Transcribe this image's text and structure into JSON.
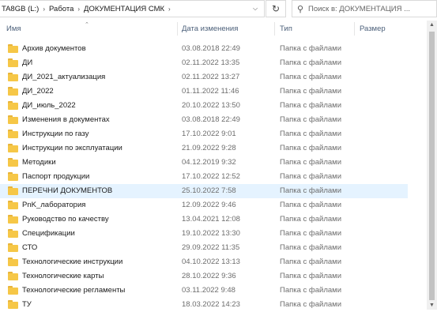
{
  "address": {
    "segments": [
      "TA8GB (L:)",
      "Работа",
      "ДОКУМЕНТАЦИЯ СМК"
    ],
    "dropdown_icon": "chevron-down-icon",
    "refresh_icon": "refresh-icon"
  },
  "search": {
    "placeholder": "Поиск в: ДОКУМЕНТАЦИЯ ...",
    "icon": "search-icon"
  },
  "columns": {
    "name": "Имя",
    "date": "Дата изменения",
    "type": "Тип",
    "size": "Размер"
  },
  "rows": [
    {
      "name": "Архив документов",
      "date": "03.08.2018 22:49",
      "type": "Папка с файлами"
    },
    {
      "name": "ДИ",
      "date": "02.11.2022 13:35",
      "type": "Папка с файлами"
    },
    {
      "name": "ДИ_2021_актуализация",
      "date": "02.11.2022 13:27",
      "type": "Папка с файлами"
    },
    {
      "name": "ДИ_2022",
      "date": "01.11.2022 11:46",
      "type": "Папка с файлами"
    },
    {
      "name": "ДИ_июль_2022",
      "date": "20.10.2022 13:50",
      "type": "Папка с файлами"
    },
    {
      "name": "Изменения в документах",
      "date": "03.08.2018 22:49",
      "type": "Папка с файлами"
    },
    {
      "name": "Инструкции по газу",
      "date": "17.10.2022 9:01",
      "type": "Папка с файлами"
    },
    {
      "name": "Инструкции по эксплуатации",
      "date": "21.09.2022 9:28",
      "type": "Папка с файлами"
    },
    {
      "name": "Методики",
      "date": "04.12.2019 9:32",
      "type": "Папка с файлами"
    },
    {
      "name": "Паспорт продукции",
      "date": "17.10.2022 12:52",
      "type": "Папка с файлами"
    },
    {
      "name": "ПЕРЕЧНИ ДОКУМЕНТОВ",
      "date": "25.10.2022 7:58",
      "type": "Папка с файлами",
      "selected": true
    },
    {
      "name": "PnK_лаборатория",
      "date": "12.09.2022 9:46",
      "type": "Папка с файлами"
    },
    {
      "name": "Руководство по качеству",
      "date": "13.04.2021 12:08",
      "type": "Папка с файлами"
    },
    {
      "name": "Спецификации",
      "date": "19.10.2022 13:30",
      "type": "Папка с файлами"
    },
    {
      "name": "СТО",
      "date": "29.09.2022 11:35",
      "type": "Папка с файлами"
    },
    {
      "name": "Технологические инструкции",
      "date": "04.10.2022 13:13",
      "type": "Папка с файлами"
    },
    {
      "name": "Технологические карты",
      "date": "28.10.2022 9:36",
      "type": "Папка с файлами"
    },
    {
      "name": "Технологические регламенты",
      "date": "03.11.2022 9:48",
      "type": "Папка с файлами"
    },
    {
      "name": "ТУ",
      "date": "18.03.2022 14:23",
      "type": "Папка с файлами"
    }
  ],
  "colors": {
    "selected_row": "#e5f3ff",
    "folder": "#f6c747",
    "header_text": "#4c607a"
  }
}
